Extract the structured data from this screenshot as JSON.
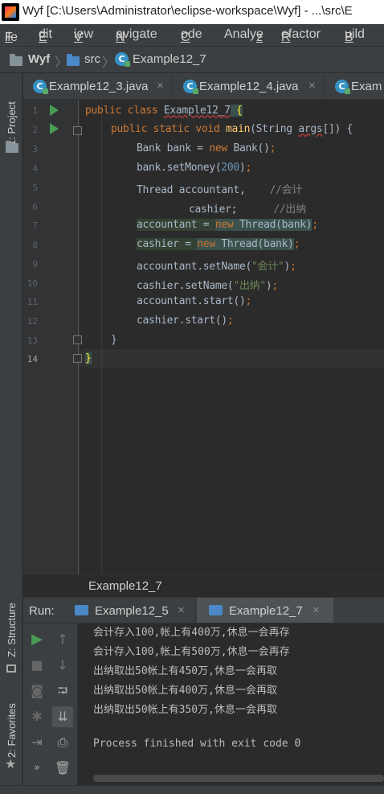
{
  "window": {
    "title": "Wyf [C:\\Users\\Administrator\\eclipse-workspace\\Wyf] - ...\\src\\E"
  },
  "menu": [
    "File",
    "Edit",
    "View",
    "Navigate",
    "Code",
    "Analyze",
    "Refactor",
    "Build"
  ],
  "menu_mnemonics": [
    "F",
    "E",
    "V",
    "N",
    "C",
    "z",
    "R",
    "B"
  ],
  "breadcrumb": {
    "project": "Wyf",
    "folder": "src",
    "file": "Example12_7"
  },
  "side_panels": {
    "project": "1: Project",
    "structure": "Z: Structure",
    "favorites": "2: Favorites"
  },
  "tabs": [
    {
      "label": "Example12_3.java",
      "close": "×"
    },
    {
      "label": "Example12_4.java",
      "close": "×"
    },
    {
      "label": "Exam"
    }
  ],
  "line_numbers": [
    "1",
    "2",
    "3",
    "4",
    "5",
    "6",
    "7",
    "8",
    "9",
    "10",
    "11",
    "12",
    "13",
    "14"
  ],
  "code": {
    "l1": {
      "kw": "public class ",
      "cls": "Example12_7",
      "brace": " {"
    },
    "l2": {
      "kw": "public static void ",
      "fn": "main",
      "p1": "(String ",
      "arg": "args",
      "p2": "[]) {"
    },
    "l3": {
      "a": "Bank bank = ",
      "kw": "new ",
      "b": "Bank()",
      "semi": ";"
    },
    "l4": {
      "a": "bank.setMoney(",
      "num": "200",
      "b": ")",
      "semi": ";"
    },
    "l5": {
      "a": "Thread accountant,    ",
      "cmt": "//会计"
    },
    "l6": {
      "a": "cashier;      ",
      "cmt": "//出纳"
    },
    "l7": {
      "a": "accountant = ",
      "kw": "new ",
      "b": "Thread(bank)",
      "semi": ";"
    },
    "l8": {
      "a": "cashier = ",
      "kw": "new ",
      "b": "Thread(bank)",
      "semi": ";"
    },
    "l9": {
      "a": "accountant.setName(",
      "str": "\"会计\"",
      "b": ")",
      "semi": ";"
    },
    "l10": {
      "a": "cashier.setName(",
      "str": "\"出纳\"",
      "b": ")",
      "semi": ";"
    },
    "l11": {
      "a": "accountant.start()",
      "semi": ";"
    },
    "l12": {
      "a": "cashier.start()",
      "semi": ";"
    },
    "l13": {
      "a": "}"
    },
    "l14": {
      "a": "}"
    }
  },
  "editor_breadcrumb": "Example12_7",
  "run": {
    "label": "Run:",
    "tabs": [
      {
        "label": "Example12_5",
        "close": "×"
      },
      {
        "label": "Example12_7",
        "close": "×"
      }
    ]
  },
  "console": [
    "会计存入100,帐上有400万,休息一会再存",
    "会计存入100,帐上有500万,休息一会再存",
    "出纳取出50帐上有450万,休息一会再取",
    "出纳取出50帐上有400万,休息一会再取",
    "出纳取出50帐上有350万,休息一会再取",
    "",
    "Process finished with exit code 0"
  ],
  "colors": {
    "keyword": "#cc7832",
    "number": "#6897bb",
    "string": "#6a8759",
    "comment": "#808080",
    "method": "#ffc66d",
    "run_green": "#499c54"
  }
}
